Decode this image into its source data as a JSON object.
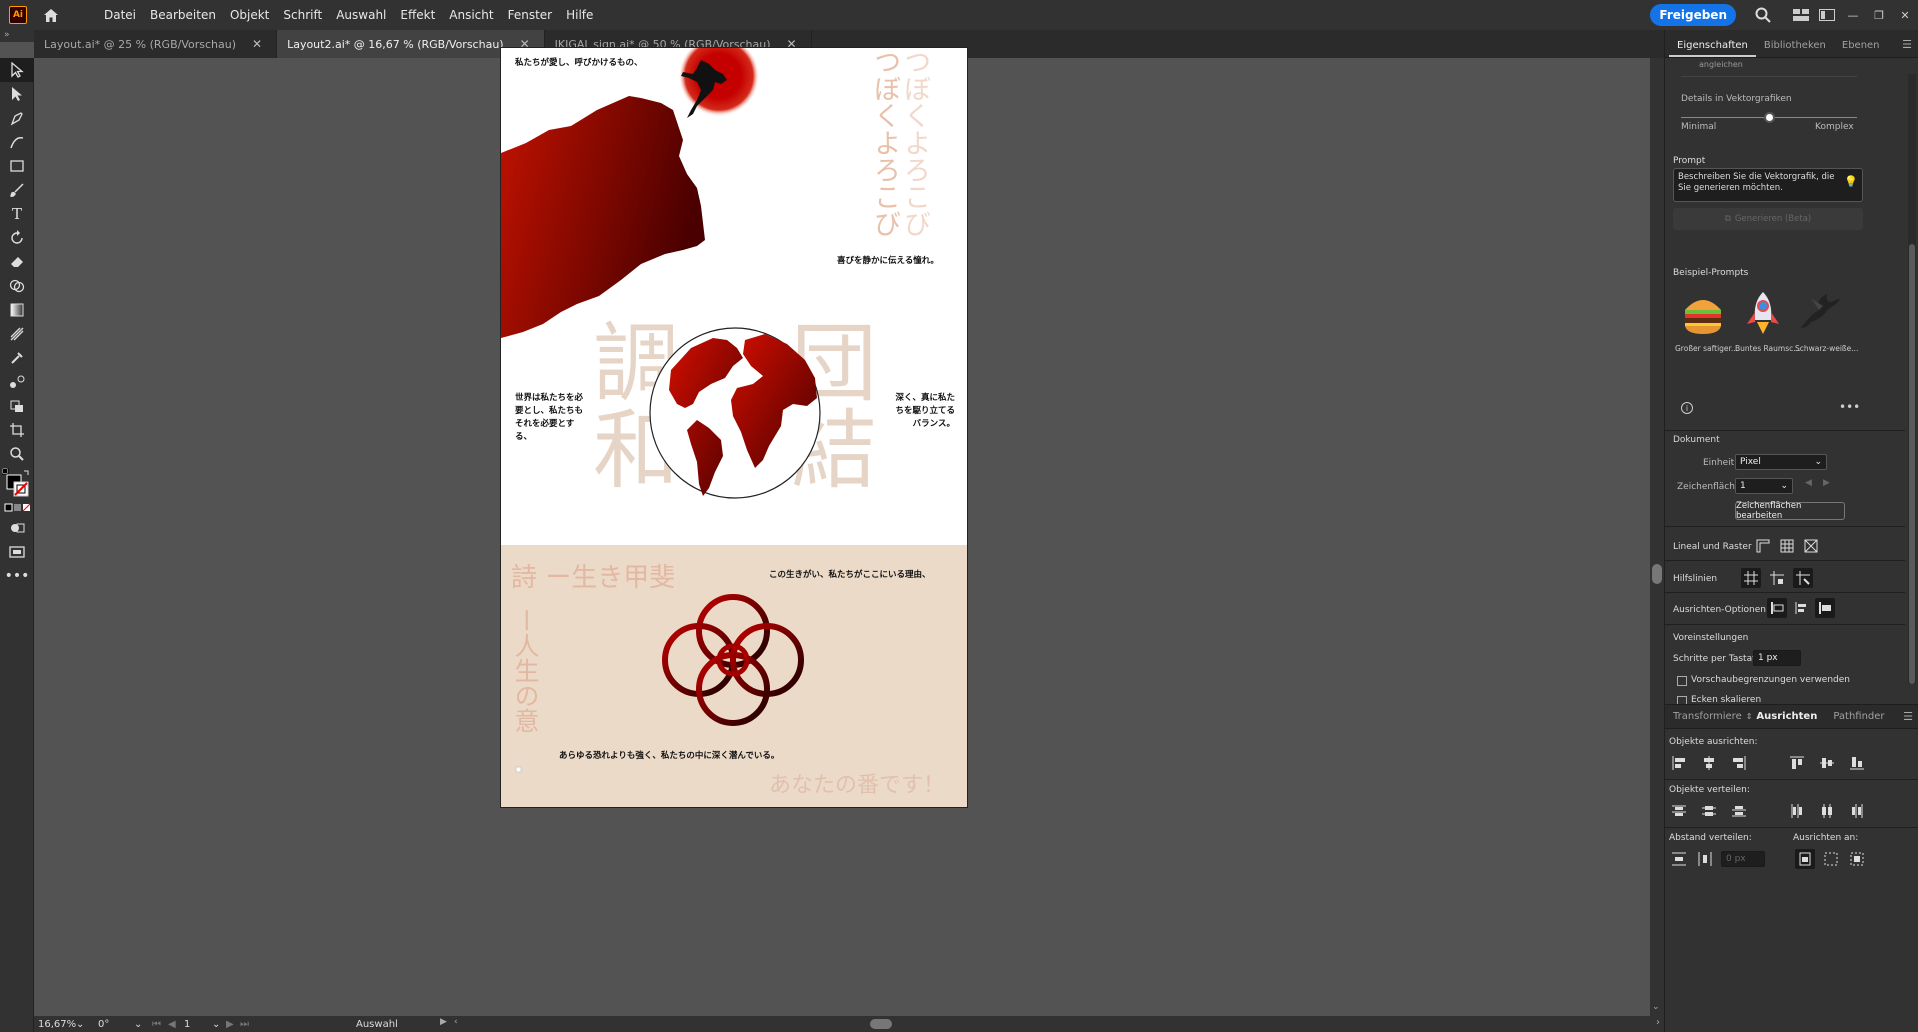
{
  "app": {
    "logo_text": "Ai",
    "home": "home-icon"
  },
  "menu": [
    "Datei",
    "Bearbeiten",
    "Objekt",
    "Schrift",
    "Auswahl",
    "Effekt",
    "Ansicht",
    "Fenster",
    "Hilfe"
  ],
  "share_label": "Freigeben",
  "tabs": [
    {
      "label": "Layout.ai* @ 25 % (RGB/Vorschau)"
    },
    {
      "label": "Layout2.ai* @ 16,67 % (RGB/Vorschau)"
    },
    {
      "label": "IKIGAI_sign.ai* @ 50 % (RGB/Vorschau)"
    }
  ],
  "status": {
    "zoom": "16,67%",
    "rotation": "0°",
    "artboard": "1",
    "mode": "Auswahl"
  },
  "artboard": {
    "text_top_left": "私たちが愛し、呼びかけるもの、",
    "vertical_left": "つぼくよろこび",
    "vertical_right": "つぼくよろこび",
    "text_right_1": "喜びを静かに伝える憧れ。",
    "kanji_tl": "調",
    "kanji_bl": "和",
    "kanji_tr": "団",
    "kanji_br": "結",
    "text_left_mid": "世界は私たちを必要とし、私たちもそれを必要とする、",
    "text_right_mid": "深く、真に私たちを駆り立てるバランス。",
    "title_bottom": "詩 ー生き甲斐",
    "text_bottom_right": "この生きがい、私たちがここにいる理由、",
    "vertical_bottom": "ー人生の意",
    "text_bottom_center": "あらゆる恐れよりも強く、私たちの中に深く潜んでいる。",
    "closing": "あなたの番です！"
  },
  "panel": {
    "tabs": [
      "Eigenschaften",
      "Bibliotheken",
      "Ebenen"
    ],
    "cut_text": "angleichen",
    "detail_label": "Details in Vektorgrafiken",
    "slider_min": "Minimal",
    "slider_max": "Komplex",
    "detail_level": 0.5,
    "prompt_label": "Prompt",
    "prompt_placeholder": "Beschreiben Sie die Vektorgrafik, die Sie generieren möchten.",
    "generate_label": "Generieren (Beta)",
    "examples_label": "Beispiel-Prompts",
    "examples": [
      "Großer saftiger...",
      "Buntes Raumsc...",
      "Schwarz-weiße..."
    ],
    "document_label": "Dokument",
    "unit_label": "Einheit:",
    "unit_value": "Pixel",
    "artboard_label": "Zeichenfläche:",
    "artboard_value": "1",
    "edit_artboards": "Zeichenflächen bearbeiten",
    "ruler_label": "Lineal und Raster",
    "guides_label": "Hilfslinien",
    "align_options_label": "Ausrichten-Optionen",
    "prefs_label": "Voreinstellungen",
    "step_label": "Schritte per Tastatur:",
    "step_value": "1 px",
    "check1": "Vorschaubegrenzungen verwenden",
    "check2": "Ecken skalieren",
    "lower_tabs": [
      "Transformiere",
      "Ausrichten",
      "Pathfinder"
    ],
    "align_objects": "Objekte ausrichten:",
    "distribute_objects": "Objekte verteilen:",
    "distribute_spacing": "Abstand verteilen:",
    "align_to": "Ausrichten an:",
    "spacing_value": "0 px"
  },
  "colors": {
    "accent": "#1473e6",
    "dark_red": "#5a0000",
    "red": "#b30000",
    "beige": "#ecdac8",
    "kanji": "#e6d5c6"
  }
}
